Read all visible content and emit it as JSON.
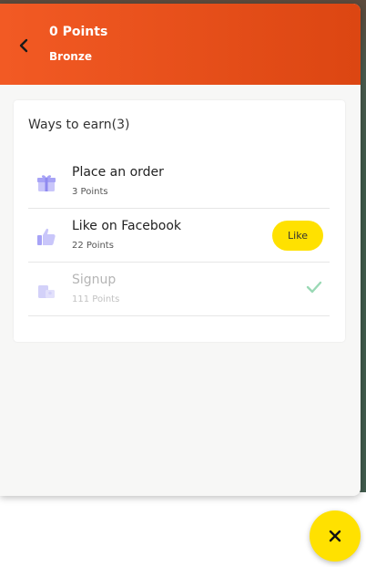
{
  "header": {
    "points_label": "0 Points",
    "tier": "Bronze"
  },
  "earn": {
    "title": "Ways to earn(3)",
    "items": [
      {
        "label": "Place an order",
        "points": "3 Points",
        "icon": "gift-icon",
        "state": "available"
      },
      {
        "label": "Like on Facebook",
        "points": "22 Points",
        "icon": "thumbs-up-icon",
        "state": "available",
        "action_label": "Like"
      },
      {
        "label": "Signup",
        "points": "111 Points",
        "icon": "signup-icon",
        "state": "completed"
      }
    ]
  },
  "colors": {
    "header_start": "#f25a24",
    "header_end": "#dc4612",
    "accent_yellow": "#ffe100",
    "icon_purple": "#a7a3f6",
    "check_green": "#9ad9b5"
  }
}
